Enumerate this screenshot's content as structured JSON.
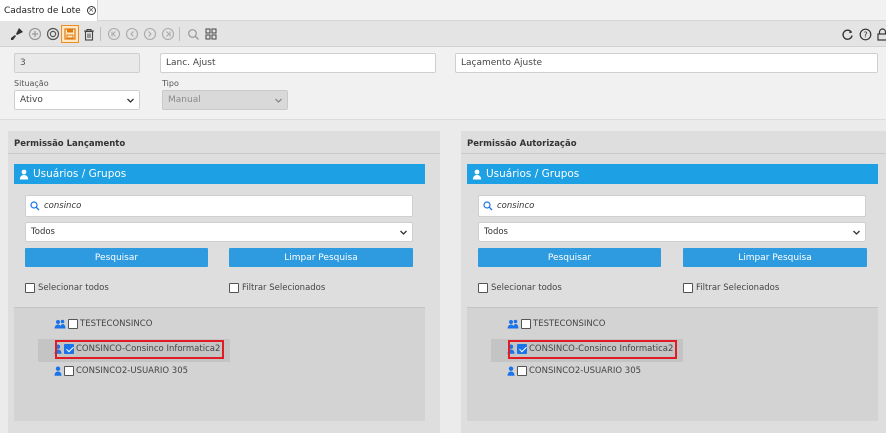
{
  "tab": {
    "title": "Cadastro de Lote"
  },
  "form": {
    "codigo_value": "3",
    "descricao_value": "Lanc. Ajust",
    "historico_value": "Laçamento Ajuste",
    "situacao_label": "Situação",
    "situacao_value": "Ativo",
    "tipo_label": "Tipo",
    "tipo_value": "Manual"
  },
  "panels": [
    {
      "title": "Permissão Lançamento",
      "header": "Usuários / Grupos",
      "search_value": "consinco",
      "filter_value": "Todos",
      "search_button": "Pesquisar",
      "clear_button": "Limpar Pesquisa",
      "select_all": "Selecionar todos",
      "filter_selected": "Filtrar Selecionados",
      "items": [
        {
          "label": "TESTECONSINCO",
          "type": "group",
          "checked": false
        },
        {
          "label": "CONSINCO-Consinco Informatica2",
          "type": "user",
          "checked": true
        },
        {
          "label": "CONSINCO2-USUARIO 305",
          "type": "user",
          "checked": false
        }
      ]
    },
    {
      "title": "Permissão Autorização",
      "header": "Usuários / Grupos",
      "search_value": "consinco",
      "filter_value": "Todos",
      "search_button": "Pesquisar",
      "clear_button": "Limpar Pesquisa",
      "select_all": "Selecionar todos",
      "filter_selected": "Filtrar Selecionados",
      "items": [
        {
          "label": "TESTECONSINCO",
          "type": "group",
          "checked": false
        },
        {
          "label": "CONSINCO-Consinco Informatica2",
          "type": "user",
          "checked": true
        },
        {
          "label": "CONSINCO2-USUARIO 305",
          "type": "user",
          "checked": false
        }
      ]
    }
  ],
  "colors": {
    "header_blue": "#1ea0e4",
    "button_blue": "#2e9be0",
    "highlight_red": "#e01b24",
    "toolbar_selected": "#f08c1e"
  },
  "icons": [
    "brush-icon",
    "add-icon",
    "gear-icon",
    "save-icon",
    "trash-icon",
    "first-icon",
    "prev-icon",
    "next-icon",
    "last-icon",
    "search-icon",
    "grid-icon",
    "refresh-icon",
    "help-icon",
    "lock-icon",
    "user-icon",
    "group-icon",
    "chevron-down-icon"
  ]
}
